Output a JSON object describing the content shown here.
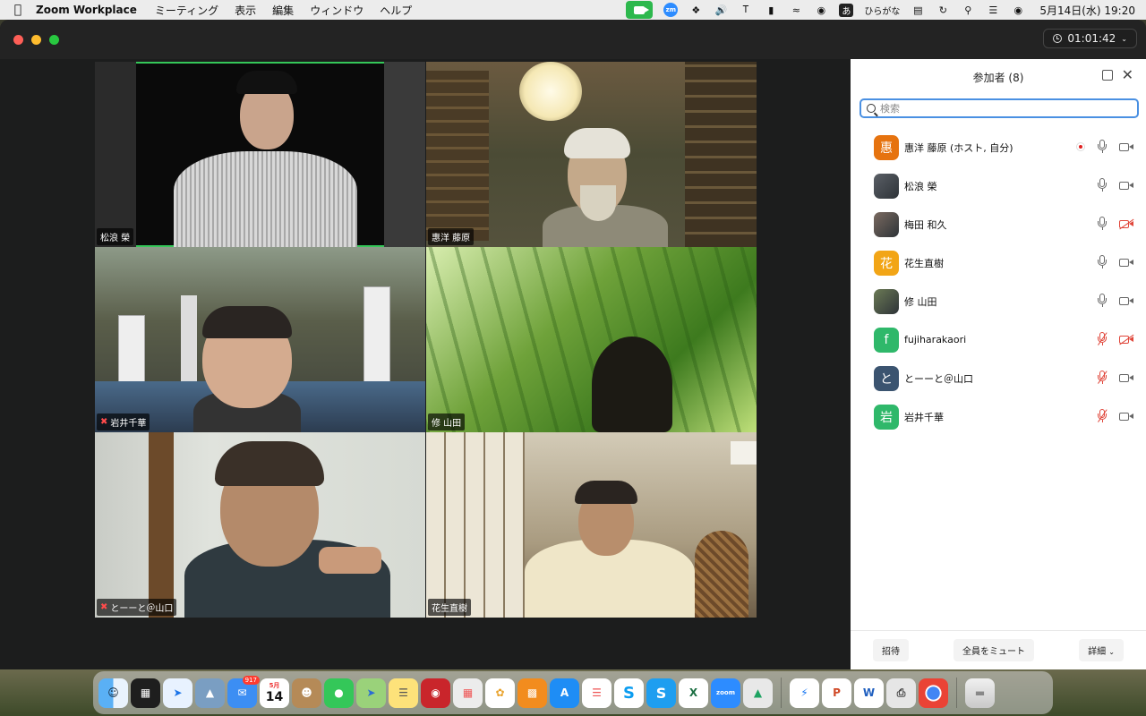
{
  "menubar": {
    "app_name": "Zoom Workplace",
    "menus": [
      "ミーティング",
      "表示",
      "編集",
      "ウィンドウ",
      "ヘルプ"
    ],
    "ime_label": "ひらがな",
    "ime_char": "あ",
    "datetime": "5月14日(水)  19:20"
  },
  "window": {
    "timer": "01:01:42"
  },
  "gallery": {
    "tiles": [
      {
        "name": "松浪 榮",
        "muted": false
      },
      {
        "name": "惠洋 藤原",
        "muted": false
      },
      {
        "name": "岩井千華",
        "muted": true
      },
      {
        "name": "修 山田",
        "muted": false
      },
      {
        "name": "とーーと＠山口",
        "muted": true
      },
      {
        "name": "花生直樹",
        "muted": false
      }
    ]
  },
  "panel": {
    "title": "参加者 (8)",
    "search_placeholder": "検索",
    "participants": [
      {
        "name": "惠洋 藤原 (ホスト, 自分)",
        "avatar": "惠",
        "color": "#e6730f",
        "mic": "on",
        "cam": "on",
        "rec": true
      },
      {
        "name": "松浪 榮",
        "avatar": "",
        "color": "#5a5f66",
        "mic": "on",
        "cam": "on",
        "rec": false
      },
      {
        "name": "梅田 和久",
        "avatar": "",
        "color": "#7a6a60",
        "mic": "on",
        "cam": "off",
        "rec": false
      },
      {
        "name": "花生直樹",
        "avatar": "花",
        "color": "#f2a516",
        "mic": "on",
        "cam": "on",
        "rec": false
      },
      {
        "name": "修 山田",
        "avatar": "",
        "color": "#6b7a55",
        "mic": "on",
        "cam": "on",
        "rec": false
      },
      {
        "name": "fujiharakaori",
        "avatar": "f",
        "color": "#2fb86a",
        "mic": "off",
        "cam": "off",
        "rec": false
      },
      {
        "name": "とーーと＠山口",
        "avatar": "と",
        "color": "#3b5470",
        "mic": "off",
        "cam": "on",
        "rec": false
      },
      {
        "name": "岩井千華",
        "avatar": "岩",
        "color": "#2fb86a",
        "mic": "off",
        "cam": "on",
        "rec": false
      }
    ],
    "footer": {
      "invite": "招待",
      "mute_all": "全員をミュート",
      "more": "詳細"
    }
  },
  "dock": {
    "mail_badge": "917",
    "calendar_month": "5月",
    "calendar_day": "14"
  }
}
